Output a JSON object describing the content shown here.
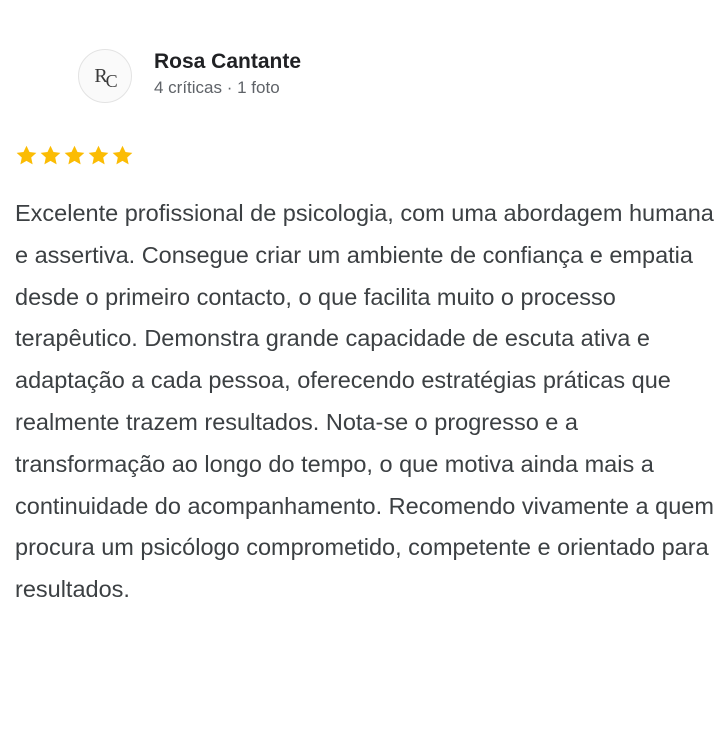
{
  "reviewer": {
    "avatar_initials": "RC",
    "name": "Rosa Cantante",
    "meta": "4 críticas · 1 foto"
  },
  "rating": {
    "stars": 5,
    "max": 5,
    "color": "#fbbc04"
  },
  "review": {
    "text": "Excelente profissional de psicologia, com uma abordagem humana e assertiva. Consegue criar um ambiente de confiança e empatia desde o primeiro contacto, o que facilita muito o processo terapêutico. Demonstra grande capacidade de escuta ativa e adaptação a cada pessoa, oferecendo estratégias práticas que realmente trazem resultados. Nota-se o progresso e a transformação ao longo do tempo, o que motiva ainda mais a continuidade do acompanhamento. Recomendo vivamente a quem procura um psicólogo comprometido, competente e orientado para resultados."
  }
}
